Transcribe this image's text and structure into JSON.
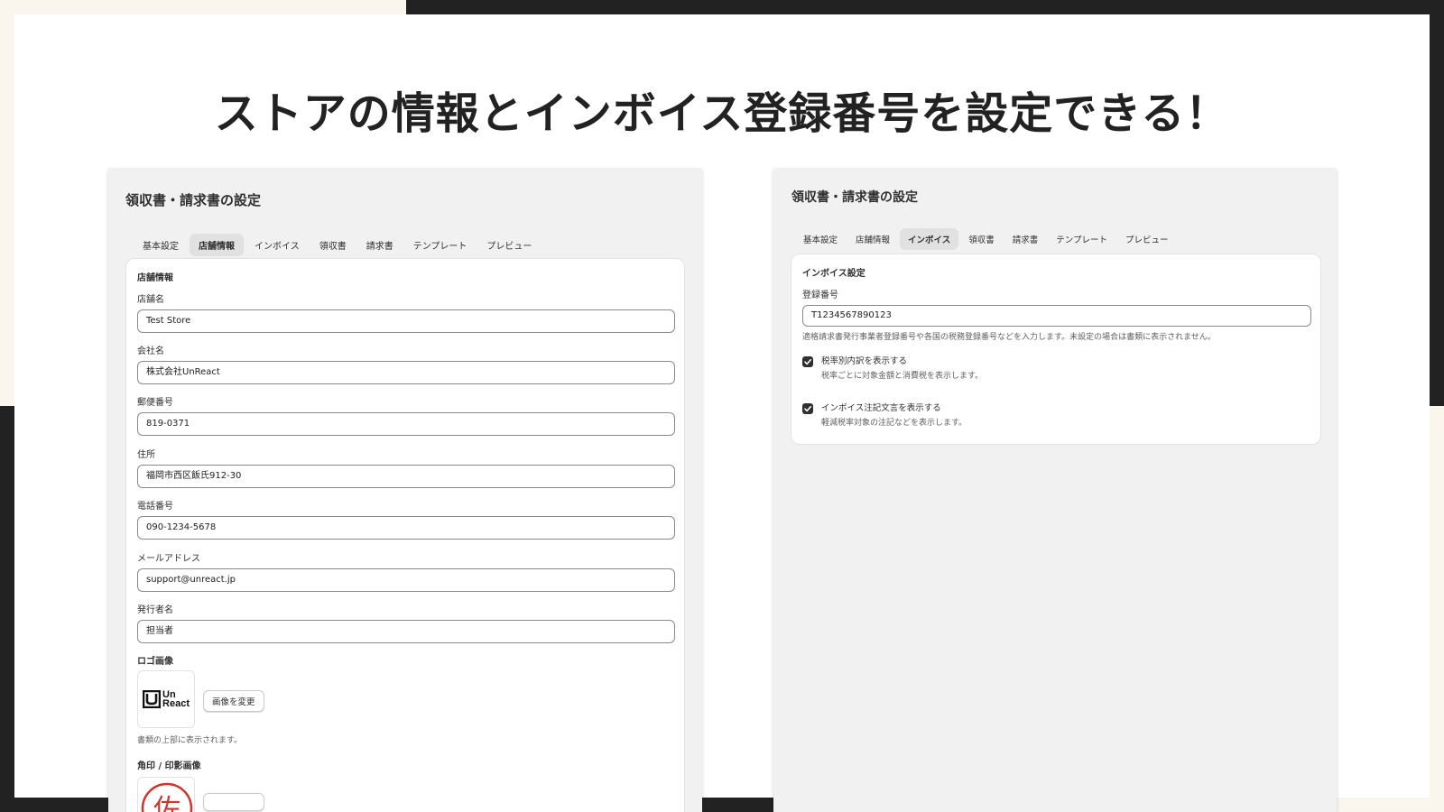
{
  "colors": {
    "background_dark": "#222222",
    "background_cream": "#faf6ee",
    "slide": "#ffffff",
    "panel": "#f1f1f1",
    "tab_active": "#e1e1e1",
    "checkbox": "#303030",
    "stamp_red": "#d0342c"
  },
  "headline": "ストアの情報とインボイス登録番号を設定できる！",
  "left_panel": {
    "title": "領収書・請求書の設定",
    "tabs": [
      {
        "label": "基本設定",
        "active": false
      },
      {
        "label": "店舗情報",
        "active": true
      },
      {
        "label": "インボイス",
        "active": false
      },
      {
        "label": "領収書",
        "active": false
      },
      {
        "label": "請求書",
        "active": false
      },
      {
        "label": "テンプレート",
        "active": false
      },
      {
        "label": "プレビュー",
        "active": false
      }
    ],
    "card_title": "店舗情報",
    "fields": [
      {
        "label": "店舗名",
        "value": "Test Store"
      },
      {
        "label": "会社名",
        "value": "株式会社UnReact"
      },
      {
        "label": "郵便番号",
        "value": "819-0371"
      },
      {
        "label": "住所",
        "value": "福岡市西区飯氏912-30"
      },
      {
        "label": "電話番号",
        "value": "090-1234-5678"
      },
      {
        "label": "メールアドレス",
        "value": "support@unreact.jp"
      },
      {
        "label": "発行者名",
        "value": "担当者"
      }
    ],
    "logo": {
      "label": "ロゴ画像",
      "logo_text_line1": "Un",
      "logo_text_line2": "React",
      "change_button": "画像を変更",
      "help": "書類の上部に表示されます。"
    },
    "stamp": {
      "label": "角印 / 印影画像",
      "char": "佐"
    }
  },
  "right_panel": {
    "title": "領収書・請求書の設定",
    "tabs": [
      {
        "label": "基本設定",
        "active": false
      },
      {
        "label": "店舗情報",
        "active": false
      },
      {
        "label": "インボイス",
        "active": true
      },
      {
        "label": "領収書",
        "active": false
      },
      {
        "label": "請求書",
        "active": false
      },
      {
        "label": "テンプレート",
        "active": false
      },
      {
        "label": "プレビュー",
        "active": false
      }
    ],
    "card_title": "インボイス設定",
    "registration": {
      "label": "登録番号",
      "value": "T1234567890123",
      "help": "適格請求書発行事業者登録番号や各国の税務登録番号などを入力します。未設定の場合は書類に表示されません。"
    },
    "checkboxes": [
      {
        "label": "税率別内訳を表示する",
        "help": "税率ごとに対象金額と消費税を表示します。",
        "checked": true
      },
      {
        "label": "インボイス注記文言を表示する",
        "help": "軽減税率対象の注記などを表示します。",
        "checked": true
      }
    ]
  }
}
